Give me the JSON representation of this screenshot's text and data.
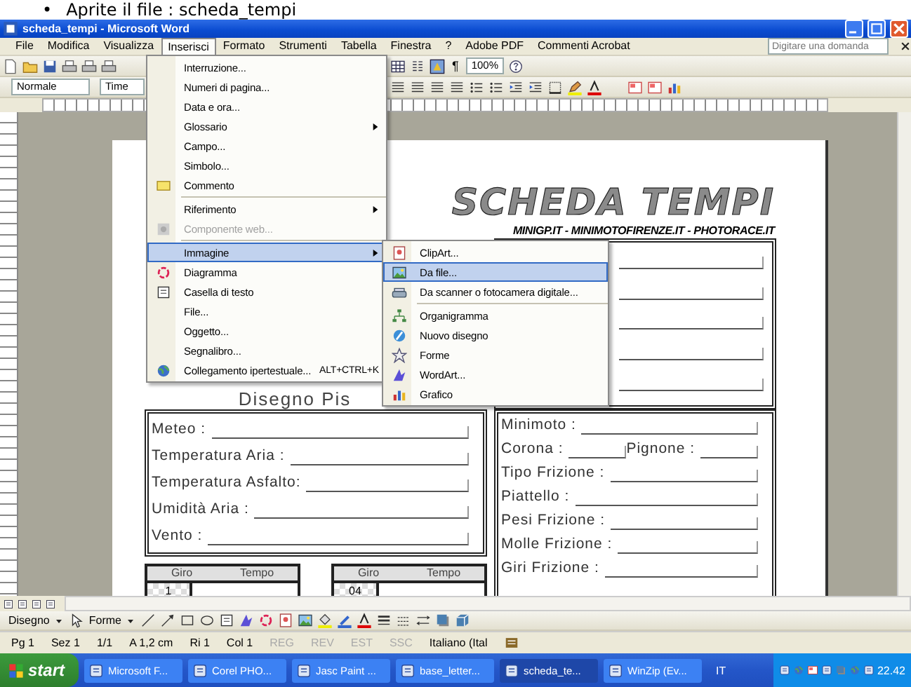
{
  "caption": {
    "bullet": "•",
    "text": "Aprite il file : scheda_tempi"
  },
  "window": {
    "title": "scheda_tempi - Microsoft Word"
  },
  "menu_bar": [
    {
      "label": "File",
      "selected": false
    },
    {
      "label": "Modifica",
      "selected": false
    },
    {
      "label": "Visualizza",
      "selected": false
    },
    {
      "label": "Inserisci",
      "selected": true
    },
    {
      "label": "Formato",
      "selected": false
    },
    {
      "label": "Strumenti",
      "selected": false
    },
    {
      "label": "Tabella",
      "selected": false
    },
    {
      "label": "Finestra",
      "selected": false
    },
    {
      "label": "?",
      "selected": false
    },
    {
      "label": "Adobe PDF",
      "selected": false
    },
    {
      "label": "Commenti Acrobat",
      "selected": false
    }
  ],
  "help_box": {
    "placeholder": "Digitare una domanda"
  },
  "standard_toolbar": {
    "pilcrow": "¶",
    "zoom": "100%"
  },
  "formatting_toolbar": {
    "style": "Normale",
    "font": "Time"
  },
  "insert_menu": {
    "items": [
      {
        "label": "Interruzione...",
        "submenu": false,
        "disabled": false,
        "selected": false,
        "separator_above": false
      },
      {
        "label": "Numeri di pagina...",
        "submenu": false,
        "disabled": false,
        "selected": false,
        "separator_above": false
      },
      {
        "label": "Data e ora...",
        "submenu": false,
        "disabled": false,
        "selected": false,
        "separator_above": false
      },
      {
        "label": "Glossario",
        "submenu": true,
        "disabled": false,
        "selected": false,
        "separator_above": false
      },
      {
        "label": "Campo...",
        "submenu": false,
        "disabled": false,
        "selected": false,
        "separator_above": false
      },
      {
        "label": "Simbolo...",
        "submenu": false,
        "disabled": false,
        "selected": false,
        "separator_above": false
      },
      {
        "label": "Commento",
        "submenu": false,
        "disabled": false,
        "selected": false,
        "separator_above": false
      },
      {
        "label": "Riferimento",
        "submenu": true,
        "disabled": false,
        "selected": false,
        "separator_above": true
      },
      {
        "label": "Componente web...",
        "submenu": false,
        "disabled": true,
        "selected": false,
        "separator_above": false
      },
      {
        "label": "Immagine",
        "submenu": true,
        "disabled": false,
        "selected": true,
        "separator_above": true
      },
      {
        "label": "Diagramma",
        "submenu": false,
        "disabled": false,
        "selected": false,
        "separator_above": false
      },
      {
        "label": "Casella di testo",
        "submenu": false,
        "disabled": false,
        "selected": false,
        "separator_above": false
      },
      {
        "label": "File...",
        "submenu": false,
        "disabled": false,
        "selected": false,
        "separator_above": false
      },
      {
        "label": "Oggetto...",
        "submenu": false,
        "disabled": false,
        "selected": false,
        "separator_above": false
      },
      {
        "label": "Segnalibro...",
        "submenu": false,
        "disabled": false,
        "selected": false,
        "separator_above": false
      },
      {
        "label": "Collegamento ipertestuale...",
        "shortcut": "ALT+CTRL+K",
        "submenu": false,
        "disabled": false,
        "selected": false,
        "separator_above": false
      }
    ]
  },
  "image_submenu": {
    "items": [
      {
        "label": "ClipArt...",
        "selected": false,
        "separator_above": false
      },
      {
        "label": "Da file...",
        "selected": true,
        "separator_above": false
      },
      {
        "label": "Da scanner o fotocamera digitale...",
        "selected": false,
        "separator_above": false
      },
      {
        "label": "Organigramma",
        "selected": false,
        "separator_above": true
      },
      {
        "label": "Nuovo disegno",
        "selected": false,
        "separator_above": false
      },
      {
        "label": "Forme",
        "selected": false,
        "separator_above": false
      },
      {
        "label": "WordArt...",
        "selected": false,
        "separator_above": false
      },
      {
        "label": "Grafico",
        "selected": false,
        "separator_above": false
      }
    ]
  },
  "document": {
    "logo_title": "SCHEDA TEMPI",
    "logo_subtitle": "MINIGP.IT - MINIMOTOFIRENZE.IT - PHOTORACE.IT",
    "track_heading": "Disegno Pis",
    "weather_fields": [
      "Meteo :",
      "Temperatura Aria :",
      "Temperatura Asfalto:",
      "Umidità Aria :",
      "Vento :"
    ],
    "bike_fields": [
      [
        "Minimoto :"
      ],
      [
        "Corona :",
        "Pignone :"
      ],
      [
        "Tipo Frizione :"
      ],
      [
        "Piattello :"
      ],
      [
        "Pesi Frizione :"
      ],
      [
        "Molle Frizione :"
      ],
      [
        "Giri Frizione :"
      ]
    ],
    "lap_tables": [
      {
        "lap_header": "Giro",
        "time_header": "Tempo",
        "first_lap": "1"
      },
      {
        "lap_header": "Giro",
        "time_header": "Tempo",
        "first_lap": "04"
      }
    ]
  },
  "drawing_toolbar": {
    "draw_menu": "Disegno",
    "shapes_menu": "Forme"
  },
  "status_bar": {
    "fields": [
      "Pg 1",
      "Sez 1",
      "1/1",
      "A 1,2 cm",
      "Ri 1",
      "Col 1"
    ],
    "modes": [
      {
        "label": "REG",
        "on": false
      },
      {
        "label": "REV",
        "on": false
      },
      {
        "label": "EST",
        "on": false
      },
      {
        "label": "SSC",
        "on": false
      }
    ],
    "language": "Italiano (Ital"
  },
  "taskbar": {
    "start": "start",
    "tasks": [
      {
        "label": "Microsoft F...",
        "selected": false
      },
      {
        "label": "Corel PHO...",
        "selected": false
      },
      {
        "label": "Jasc Paint ...",
        "selected": false
      },
      {
        "label": "base_letter...",
        "selected": false
      },
      {
        "label": "scheda_te...",
        "selected": true
      },
      {
        "label": "WinZip (Ev...",
        "selected": false
      }
    ],
    "language": "IT",
    "clock": "22.42"
  }
}
